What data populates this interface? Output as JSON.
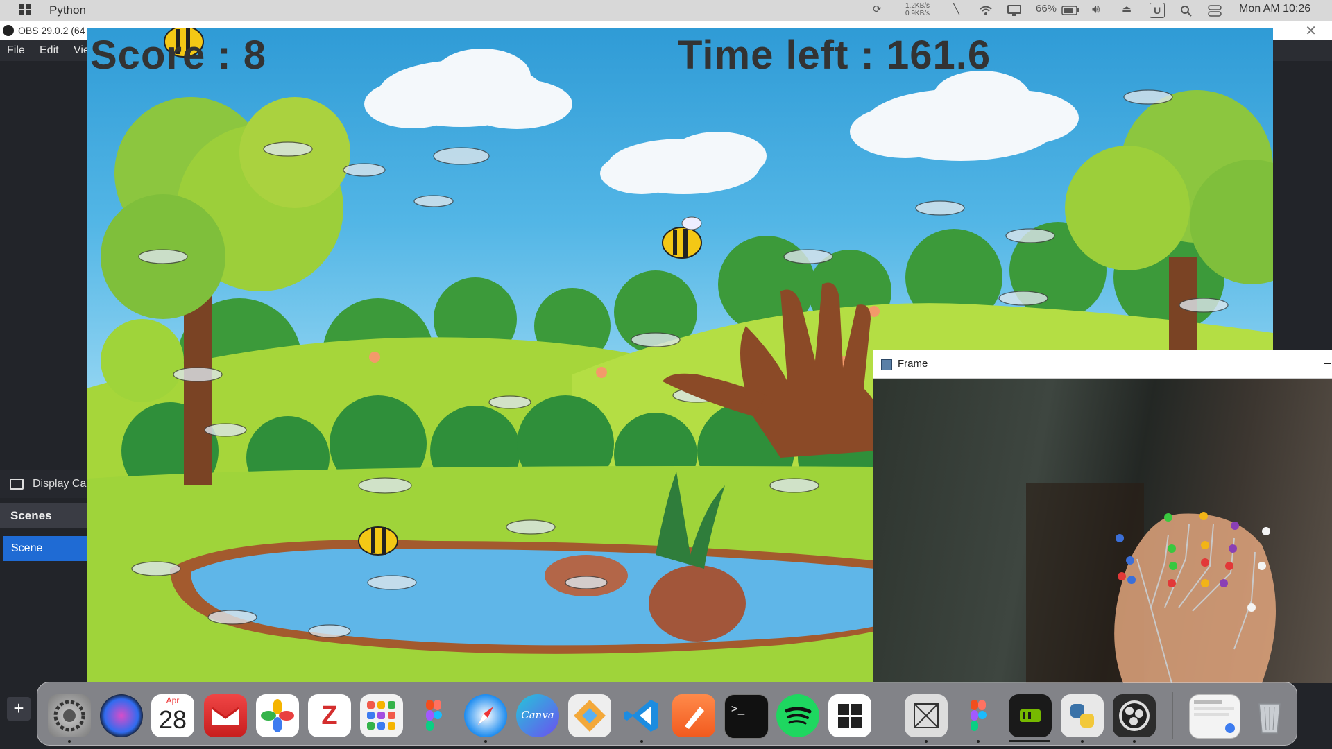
{
  "menubar": {
    "app_name": "Python",
    "net_up": "1.2KB/s",
    "net_down": "0.9KB/s",
    "battery": "66%",
    "clock": "Mon AM 10:26"
  },
  "obs": {
    "title": "OBS 29.0.2 (64",
    "menu": [
      "File",
      "Edit",
      "Vie"
    ],
    "source_label": "Display Ca",
    "scenes_header": "Scenes",
    "scene_item": "Scene",
    "add_label": "+"
  },
  "game": {
    "score_text": "Score : 8",
    "timer_text": "Time left : 161.6"
  },
  "frame": {
    "title": "Frame",
    "minimize_label": "–"
  },
  "dock": {
    "calendar_month": "Apr",
    "calendar_day": "28",
    "canva_label": "Canva",
    "items": [
      "system-preferences",
      "siri",
      "calendar",
      "gmail",
      "photos",
      "zotero",
      "launchpad",
      "figma",
      "safari",
      "canva",
      "git-tool",
      "vscode",
      "pen-tool",
      "terminal",
      "spotify",
      "windows",
      "x-window",
      "figma-2",
      "nvidia",
      "python",
      "obs",
      "preview",
      "trash"
    ]
  },
  "colors": {
    "obs_scene_selected": "#1f6bd4",
    "sky_top": "#2f9bd6",
    "grass": "#9fd43a"
  }
}
